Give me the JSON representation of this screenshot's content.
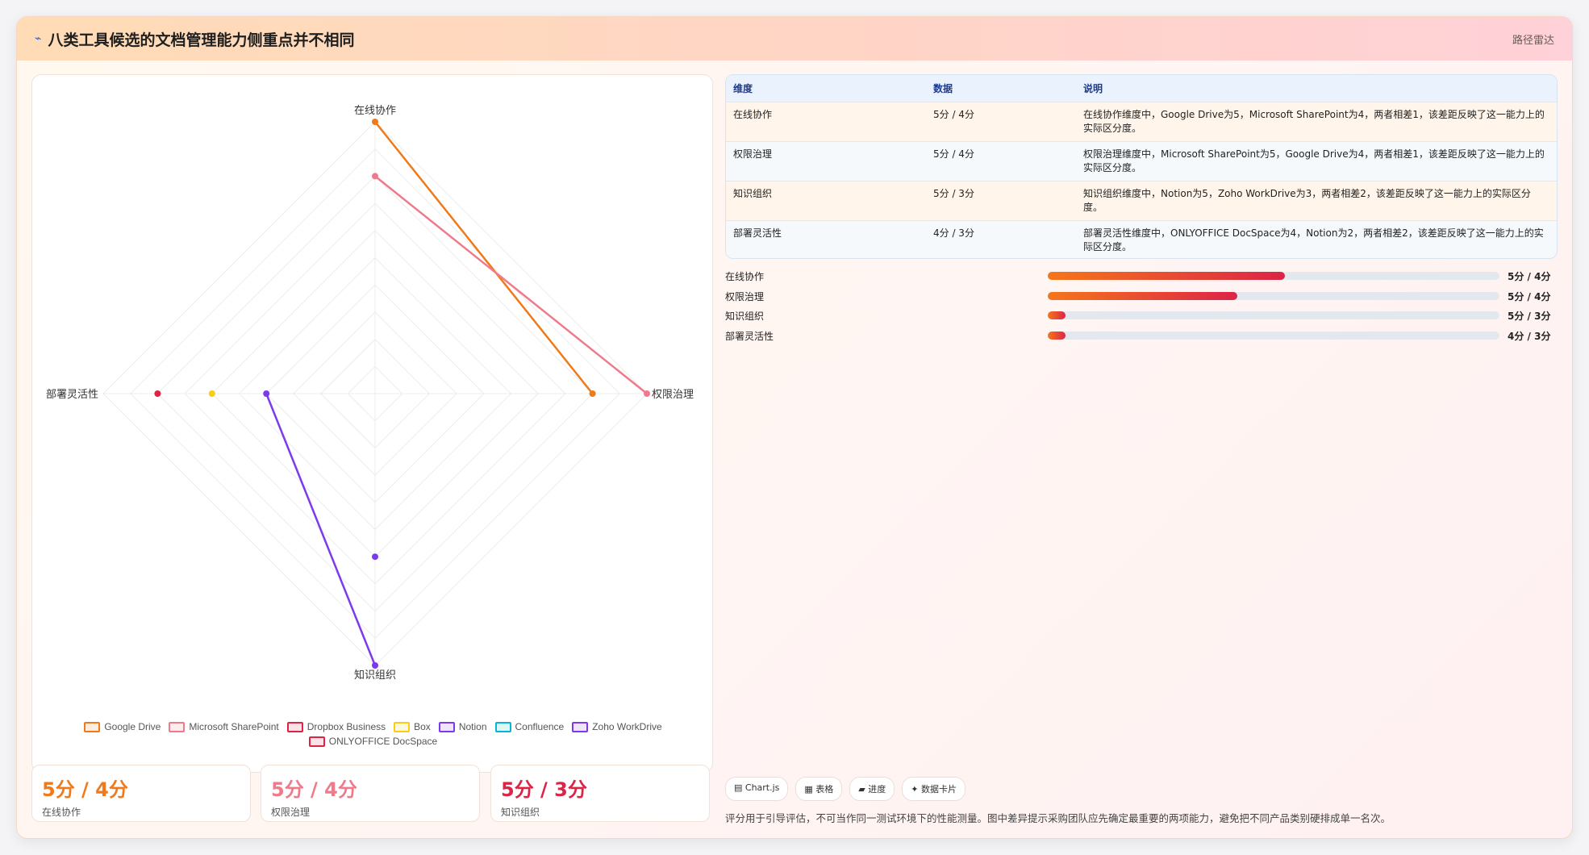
{
  "header": {
    "icon": "chart-line-icon",
    "title": "八类工具候选的文档管理能力侧重点并不相同",
    "tag": "路径雷达"
  },
  "chart_data": {
    "type": "radar",
    "axes": [
      "在线协作",
      "权限治理",
      "知识组织",
      "部署灵活性"
    ],
    "r_range": [
      0,
      5
    ],
    "grid": true,
    "legend_position": "bottom",
    "series": [
      {
        "name": "Google Drive",
        "color": "#f07a1a",
        "values": [
          5,
          4,
          null,
          null
        ]
      },
      {
        "name": "Microsoft SharePoint",
        "color": "#f07a8a",
        "values": [
          4,
          5,
          null,
          null
        ]
      },
      {
        "name": "Dropbox Business",
        "color": "#dc2447",
        "values": [
          null,
          null,
          null,
          4
        ]
      },
      {
        "name": "Box",
        "color": "#facc15",
        "values": [
          null,
          null,
          null,
          3
        ]
      },
      {
        "name": "Notion",
        "color": "#7c3aed",
        "values": [
          null,
          null,
          5,
          2
        ]
      },
      {
        "name": "Confluence",
        "color": "#06b6d4",
        "values": [
          null,
          null,
          null,
          null
        ]
      },
      {
        "name": "Zoho WorkDrive",
        "color": "#7c3aed",
        "values": [
          null,
          null,
          3,
          null
        ]
      },
      {
        "name": "ONLYOFFICE DocSpace",
        "color": "#dc2447",
        "values": [
          null,
          null,
          null,
          null
        ]
      }
    ]
  },
  "table": {
    "headers": [
      "维度",
      "数据",
      "说明"
    ],
    "rows": [
      {
        "dim": "在线协作",
        "data": "5分 / 4分",
        "desc": "在线协作维度中，Google Drive为5，Microsoft SharePoint为4，两者相差1，该差距反映了这一能力上的实际区分度。"
      },
      {
        "dim": "权限治理",
        "data": "5分 / 4分",
        "desc": "权限治理维度中，Microsoft SharePoint为5，Google Drive为4，两者相差1，该差距反映了这一能力上的实际区分度。"
      },
      {
        "dim": "知识组织",
        "data": "5分 / 3分",
        "desc": "知识组织维度中，Notion为5，Zoho WorkDrive为3，两者相差2，该差距反映了这一能力上的实际区分度。"
      },
      {
        "dim": "部署灵活性",
        "data": "4分 / 3分",
        "desc": "部署灵活性维度中，ONLYOFFICE DocSpace为4，Notion为2，两者相差2，该差距反映了这一能力上的实际区分度。"
      }
    ]
  },
  "progress": [
    {
      "label": "在线协作",
      "value": "5分 / 4分",
      "fill": 0.525
    },
    {
      "label": "权限治理",
      "value": "5分 / 4分",
      "fill": 0.42
    },
    {
      "label": "知识组织",
      "value": "5分 / 3分",
      "fill": 0.04
    },
    {
      "label": "部署灵活性",
      "value": "4分 / 3分",
      "fill": 0.04
    }
  ],
  "kpis": [
    {
      "value": "5分 / 4分",
      "label": "在线协作",
      "color": "#f07a1a"
    },
    {
      "value": "5分 / 4分",
      "label": "权限治理",
      "color": "#f07a8a"
    },
    {
      "value": "5分 / 3分",
      "label": "知识组织",
      "color": "#dc2447"
    }
  ],
  "chips": [
    "▤ Chart.js",
    "▦ 表格",
    "▰ 进度",
    "✦ 数据卡片"
  ],
  "footnote": "评分用于引导评估，不可当作同一测试环境下的性能测量。图中差异提示采购团队应先确定最重要的两项能力，避免把不同产品类别硬排成单一名次。"
}
